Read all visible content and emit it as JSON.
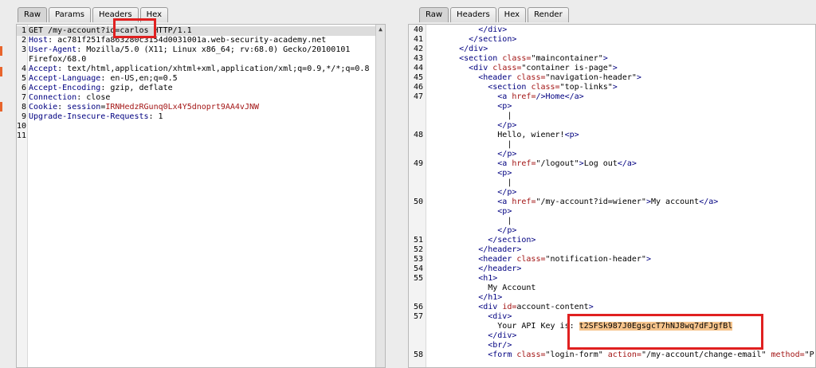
{
  "request": {
    "tabs": [
      "Raw",
      "Params",
      "Headers",
      "Hex"
    ],
    "lines": [
      {
        "n": "1",
        "parts": [
          {
            "t": "GET /my-account?id=carlos HTTP/1.1",
            "c": ""
          }
        ]
      },
      {
        "n": "2",
        "parts": [
          {
            "t": "Host",
            "c": "k"
          },
          {
            "t": ": ac781f251fa",
            "c": ""
          },
          {
            "t": "863280c3154d0031001a.web-security-academy.net",
            "c": ""
          }
        ]
      },
      {
        "n": "3",
        "parts": [
          {
            "t": "User-Agent",
            "c": "k"
          },
          {
            "t": ": Mozilla/5.0 (X11; Linux x86_64; rv:68.0) Gecko/20100101",
            "c": ""
          }
        ]
      },
      {
        "n": "",
        "parts": [
          {
            "t": "Firefox/68.0",
            "c": ""
          }
        ]
      },
      {
        "n": "4",
        "parts": [
          {
            "t": "Accept",
            "c": "k"
          },
          {
            "t": ": text/html,application/xhtml+xml,application/xml;q=0.9,*/*;q=0.8",
            "c": ""
          }
        ]
      },
      {
        "n": "5",
        "parts": [
          {
            "t": "Accept-Language",
            "c": "k"
          },
          {
            "t": ": en-US,en;q=0.5",
            "c": ""
          }
        ]
      },
      {
        "n": "6",
        "parts": [
          {
            "t": "Accept-Encoding",
            "c": "k"
          },
          {
            "t": ": gzip, deflate",
            "c": ""
          }
        ]
      },
      {
        "n": "7",
        "parts": [
          {
            "t": "Connection",
            "c": "k"
          },
          {
            "t": ": close",
            "c": ""
          }
        ]
      },
      {
        "n": "8",
        "parts": [
          {
            "t": "Cookie",
            "c": "k"
          },
          {
            "t": ": ",
            "c": ""
          },
          {
            "t": "session",
            "c": "k"
          },
          {
            "t": "=",
            "c": ""
          },
          {
            "t": "IRNHedzRGunq0Lx4Y5dnoprt9AA4vJNW",
            "c": "s"
          }
        ]
      },
      {
        "n": "9",
        "parts": [
          {
            "t": "Upgrade-Insecure-Requests",
            "c": "k"
          },
          {
            "t": ": 1",
            "c": ""
          }
        ]
      },
      {
        "n": "10",
        "parts": []
      },
      {
        "n": "11",
        "parts": []
      }
    ]
  },
  "response": {
    "tabs": [
      "Raw",
      "Headers",
      "Hex",
      "Render"
    ],
    "lines": [
      {
        "n": "40",
        "parts": [
          {
            "t": "          </div>",
            "c": "t"
          }
        ]
      },
      {
        "n": "41",
        "parts": [
          {
            "t": "        </section>",
            "c": "t"
          }
        ]
      },
      {
        "n": "42",
        "parts": [
          {
            "t": "      </div>",
            "c": "t"
          }
        ]
      },
      {
        "n": "43",
        "parts": [
          {
            "t": "      <section ",
            "c": "t"
          },
          {
            "t": "class=",
            "c": "a"
          },
          {
            "t": "\"maincontainer\"",
            "c": ""
          },
          {
            "t": ">",
            "c": "t"
          }
        ]
      },
      {
        "n": "44",
        "parts": [
          {
            "t": "        <div ",
            "c": "t"
          },
          {
            "t": "class=",
            "c": "a"
          },
          {
            "t": "\"container is-page\"",
            "c": ""
          },
          {
            "t": ">",
            "c": "t"
          }
        ]
      },
      {
        "n": "45",
        "parts": [
          {
            "t": "          <header ",
            "c": "t"
          },
          {
            "t": "class=",
            "c": "a"
          },
          {
            "t": "\"navigation-header\"",
            "c": ""
          },
          {
            "t": ">",
            "c": "t"
          }
        ]
      },
      {
        "n": "46",
        "parts": [
          {
            "t": "            <section ",
            "c": "t"
          },
          {
            "t": "class=",
            "c": "a"
          },
          {
            "t": "\"top-links\"",
            "c": ""
          },
          {
            "t": ">",
            "c": "t"
          }
        ]
      },
      {
        "n": "47",
        "parts": [
          {
            "t": "              <a ",
            "c": "t"
          },
          {
            "t": "href=",
            "c": "a"
          },
          {
            "t": "/>Home</a>",
            "c": "t"
          }
        ]
      },
      {
        "n": "",
        "parts": [
          {
            "t": "              <p>",
            "c": "t"
          }
        ]
      },
      {
        "n": "",
        "parts": [
          {
            "t": "                |",
            "c": ""
          }
        ]
      },
      {
        "n": "",
        "parts": [
          {
            "t": "              </p>",
            "c": "t"
          }
        ]
      },
      {
        "n": "48",
        "parts": [
          {
            "t": "              Hello, wiener!",
            "c": ""
          },
          {
            "t": "<p>",
            "c": "t"
          }
        ]
      },
      {
        "n": "",
        "parts": [
          {
            "t": "                |",
            "c": ""
          }
        ]
      },
      {
        "n": "",
        "parts": [
          {
            "t": "              </p>",
            "c": "t"
          }
        ]
      },
      {
        "n": "49",
        "parts": [
          {
            "t": "              <a ",
            "c": "t"
          },
          {
            "t": "href=",
            "c": "a"
          },
          {
            "t": "\"/logout\"",
            "c": ""
          },
          {
            "t": ">",
            "c": "t"
          },
          {
            "t": "Log out",
            "c": ""
          },
          {
            "t": "</a>",
            "c": "t"
          }
        ]
      },
      {
        "n": "",
        "parts": [
          {
            "t": "              <p>",
            "c": "t"
          }
        ]
      },
      {
        "n": "",
        "parts": [
          {
            "t": "                |",
            "c": ""
          }
        ]
      },
      {
        "n": "",
        "parts": [
          {
            "t": "              </p>",
            "c": "t"
          }
        ]
      },
      {
        "n": "50",
        "parts": [
          {
            "t": "              <a ",
            "c": "t"
          },
          {
            "t": "href=",
            "c": "a"
          },
          {
            "t": "\"/my-account?id=wiener\"",
            "c": ""
          },
          {
            "t": ">",
            "c": "t"
          },
          {
            "t": "My account",
            "c": ""
          },
          {
            "t": "</a>",
            "c": "t"
          }
        ]
      },
      {
        "n": "",
        "parts": [
          {
            "t": "              <p>",
            "c": "t"
          }
        ]
      },
      {
        "n": "",
        "parts": [
          {
            "t": "                |",
            "c": ""
          }
        ]
      },
      {
        "n": "",
        "parts": [
          {
            "t": "              </p>",
            "c": "t"
          }
        ]
      },
      {
        "n": "51",
        "parts": [
          {
            "t": "            </section>",
            "c": "t"
          }
        ]
      },
      {
        "n": "52",
        "parts": [
          {
            "t": "          </header>",
            "c": "t"
          }
        ]
      },
      {
        "n": "53",
        "parts": [
          {
            "t": "          <header ",
            "c": "t"
          },
          {
            "t": "class=",
            "c": "a"
          },
          {
            "t": "\"notification-header\"",
            "c": ""
          },
          {
            "t": ">",
            "c": "t"
          }
        ]
      },
      {
        "n": "54",
        "parts": [
          {
            "t": "          </header>",
            "c": "t"
          }
        ]
      },
      {
        "n": "55",
        "parts": [
          {
            "t": "          <h1>",
            "c": "t"
          }
        ]
      },
      {
        "n": "",
        "parts": [
          {
            "t": "            My Account",
            "c": ""
          }
        ]
      },
      {
        "n": "",
        "parts": [
          {
            "t": "          </h1>",
            "c": "t"
          }
        ]
      },
      {
        "n": "56",
        "parts": [
          {
            "t": "          <div ",
            "c": "t"
          },
          {
            "t": "id=",
            "c": "a"
          },
          {
            "t": "account-content",
            "c": ""
          },
          {
            "t": ">",
            "c": "t"
          }
        ]
      },
      {
        "n": "57",
        "parts": [
          {
            "t": "            <div>",
            "c": "t"
          }
        ]
      },
      {
        "n": "",
        "parts": [
          {
            "t": "              Your API Key is: ",
            "c": ""
          },
          {
            "t": "t2SFSk987J0EgsgcT7hNJ8wq7dFJgfBl",
            "c": "key"
          }
        ]
      },
      {
        "n": "",
        "parts": [
          {
            "t": "            </div>",
            "c": "t"
          }
        ]
      },
      {
        "n": "",
        "parts": [
          {
            "t": "            <br/>",
            "c": "t"
          }
        ]
      },
      {
        "n": "58",
        "parts": [
          {
            "t": "            <form ",
            "c": "t"
          },
          {
            "t": "class=",
            "c": "a"
          },
          {
            "t": "\"login-form\" ",
            "c": ""
          },
          {
            "t": "action=",
            "c": "a"
          },
          {
            "t": "\"/my-account/change-email\" ",
            "c": ""
          },
          {
            "t": "method=",
            "c": "a"
          },
          {
            "t": "\"P",
            "c": ""
          }
        ]
      }
    ]
  }
}
